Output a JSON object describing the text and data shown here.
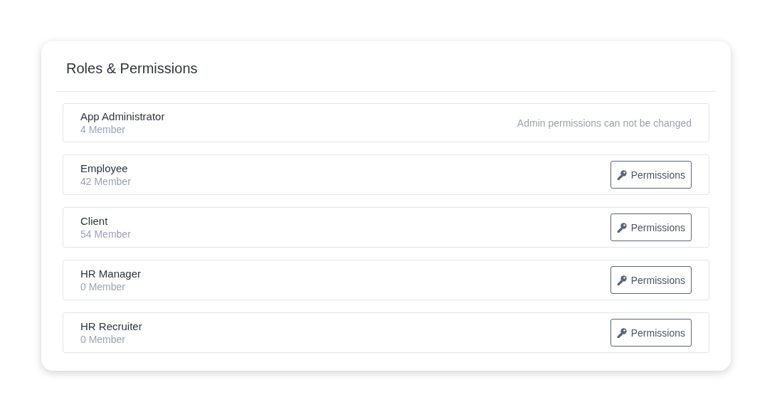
{
  "card": {
    "title": "Roles & Permissions"
  },
  "roles": [
    {
      "kind": "locked",
      "name": "App Administrator",
      "members": "4 Member",
      "note": "Admin permissions can not be changed"
    },
    {
      "kind": "editable",
      "name": "Employee",
      "members": "42 Member",
      "button": "Permissions"
    },
    {
      "kind": "editable",
      "name": "Client",
      "members": "54 Member",
      "button": "Permissions"
    },
    {
      "kind": "editable",
      "name": "HR Manager",
      "members": "0 Member",
      "button": "Permissions"
    },
    {
      "kind": "editable",
      "name": "HR Recruiter",
      "members": "0 Member",
      "button": "Permissions"
    }
  ]
}
